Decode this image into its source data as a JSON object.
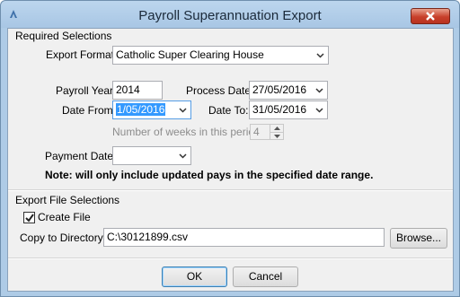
{
  "window": {
    "title": "Payroll Superannuation Export"
  },
  "required_section": {
    "label": "Required Selections"
  },
  "export_format": {
    "label": "Export Format:",
    "value": "Catholic Super Clearing House"
  },
  "payroll_year": {
    "label": "Payroll Year:",
    "value": "2014"
  },
  "process_date": {
    "label": "Process Date:",
    "value": "27/05/2016"
  },
  "date_from": {
    "label": "Date From:",
    "value": "1/05/2016"
  },
  "date_to": {
    "label": "Date To:",
    "value": "31/05/2016"
  },
  "weeks": {
    "label": "Number of weeks in this period:",
    "value": "4"
  },
  "payment_date": {
    "label": "Payment Date:",
    "value": ""
  },
  "note": "Note: will only include updated pays in the specified date range.",
  "export_file_section": {
    "label": "Export File Selections"
  },
  "create_file": {
    "label": "Create File",
    "checked": true
  },
  "copy_dir": {
    "label": "Copy to Directory:",
    "value": "C:\\30121899.csv"
  },
  "buttons": {
    "browse": "Browse...",
    "ok": "OK",
    "cancel": "Cancel"
  },
  "icons": {
    "app": "payroll-app-icon",
    "close": "close-icon",
    "dropdown": "chevron-down-icon"
  }
}
